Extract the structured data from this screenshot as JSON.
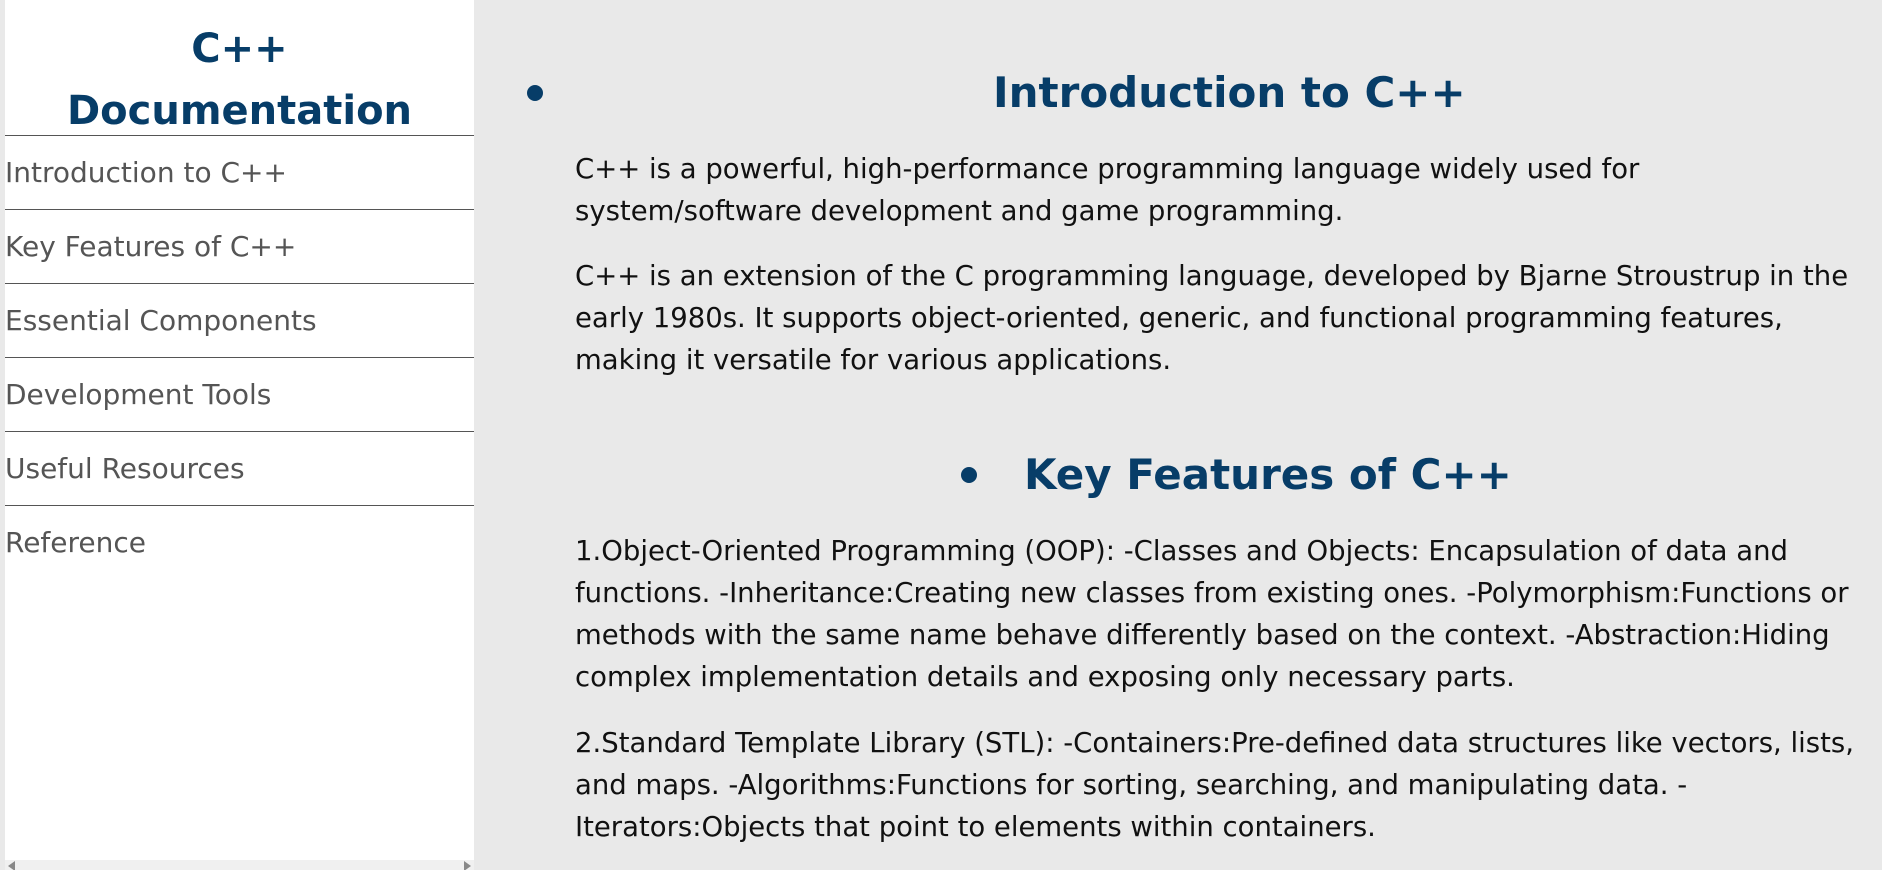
{
  "sidebar": {
    "title_line1": "C++",
    "title_line2": "Documentation",
    "items": [
      {
        "label": "Introduction to C++"
      },
      {
        "label": "Key Features of C++"
      },
      {
        "label": "Essential Components"
      },
      {
        "label": "Development Tools"
      },
      {
        "label": "Useful Resources"
      },
      {
        "label": "Reference"
      }
    ]
  },
  "main": {
    "sections": [
      {
        "title": "Introduction to C++",
        "paragraphs": [
          "C++ is a powerful, high-performance programming language widely used for system/software development and game programming.",
          "C++ is an extension of the C programming language, developed by Bjarne Stroustrup in the early 1980s. It supports object-oriented, generic, and functional programming features, making it versatile for various applications."
        ]
      },
      {
        "title": "Key Features of C++",
        "paragraphs": [
          "1.Object-Oriented Programming (OOP): -Classes and Objects: Encapsulation of data and functions. -Inheritance:Creating new classes from existing ones. -Polymorphism:Functions or methods with the same name behave differently based on the context. -Abstraction:Hiding complex implementation details and exposing only necessary parts.",
          "2.Standard Template Library (STL): -Containers:Pre-defined data structures like vectors, lists, and maps. -Algorithms:Functions for sorting, searching, and manipulating data. -Iterators:Objects that point to elements within containers."
        ]
      }
    ]
  },
  "colors": {
    "accent": "#073d68",
    "content_bg": "#e9e9e9",
    "sidebar_bg": "#ffffff"
  }
}
